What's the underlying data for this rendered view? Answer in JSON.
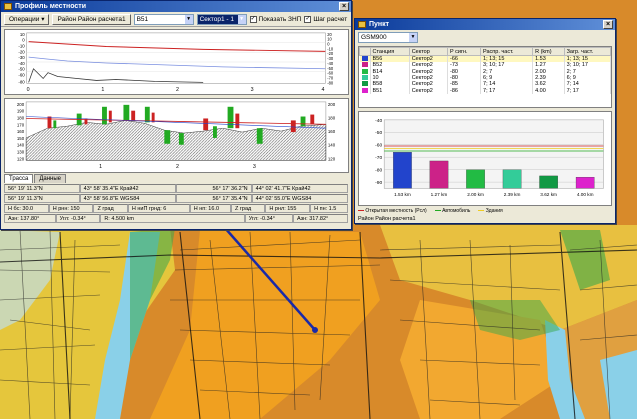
{
  "map": {
    "colors": {
      "orange": "#e8901c",
      "yellow": "#e8d040",
      "green": "#3aa84a",
      "water": "#8ad0e8",
      "route": "#1a2aa8"
    }
  },
  "profile_window": {
    "title": "Профиль местности",
    "toolbar": {
      "operations_label": "Операции",
      "link_label": "Район Район расчета1",
      "station_value": "B51",
      "sector_value": "Сектор1 - 1",
      "show_zone_label": "Показать ЗНП",
      "step_label": "Шаг расчет"
    },
    "top_chart": {
      "x_ticks": [
        "0",
        "1",
        "2",
        "3",
        "4"
      ],
      "y_left_ticks": [
        "10",
        "0",
        "-10",
        "-20",
        "-30",
        "-40",
        "-50",
        "-60",
        "-80"
      ],
      "y_right_ticks": [
        "20",
        "10",
        "0",
        "-10",
        "-20",
        "-30",
        "-40",
        "-50",
        "-60",
        "-70",
        "-80"
      ]
    },
    "bottom_chart": {
      "x_ticks": [
        "1",
        "2",
        "3"
      ],
      "y_left_ticks": [
        "200",
        "190",
        "180",
        "170",
        "160",
        "150",
        "140",
        "130",
        "120"
      ],
      "y_right_ticks": [
        "200",
        "180",
        "160",
        "140",
        "120"
      ]
    },
    "tabs": [
      "Трасса",
      "Данные"
    ],
    "status_rows": [
      [
        "56° 19' 11.3\"N",
        "43° 58' 35.4\"E Край42",
        "56° 17' 36.2\"N",
        "44° 02' 41.7\"E Край42"
      ],
      [
        "56° 19' 11.3\"N",
        "43° 58' 56.8\"E WGS84",
        "56° 17' 35.4\"N",
        "44° 02' 55.0\"E WGS84"
      ],
      [
        "Н бс: 30.0",
        "Н рнн: 150",
        "Z град",
        "Н ниП грнд: 6",
        "Н нп: 16.0",
        "Z град",
        "Н рнл: 155",
        "Н пн: 1.5"
      ],
      [
        "Азн: 137.80°",
        "Угл: -0.34°",
        "R: 4.500 km",
        "Угл: -0.34°",
        "Азн: 317.82°"
      ]
    ]
  },
  "station_window": {
    "title": "Пункт",
    "dropdown_value": "GSM900",
    "columns": [
      "Станция",
      "Сектор",
      "P сигн.",
      "Распр. част.",
      "R (km)",
      "Загр. част."
    ],
    "rows": [
      {
        "color": "#2244cc",
        "station": "B56",
        "sector": "Сектор2",
        "p": "-66",
        "freq": "1; 13; 15",
        "r": "1.53",
        "load": "1; 13; 15"
      },
      {
        "color": "#cc2288",
        "station": "B52",
        "sector": "Сектор2",
        "p": "-73",
        "freq": "3; 10; 17",
        "r": "1.27",
        "load": "3; 10; 17"
      },
      {
        "color": "#22bb44",
        "station": "B14",
        "sector": "Сектор2",
        "p": "-80",
        "freq": "2; 7",
        "r": "2.00",
        "load": "2; 7"
      },
      {
        "color": "#33cc99",
        "station": "10",
        "sector": "Сектор2",
        "p": "-80",
        "freq": "6; 9",
        "r": "2.39",
        "load": "6; 9"
      },
      {
        "color": "#119944",
        "station": "B58",
        "sector": "Сектор2",
        "p": "-85",
        "freq": "7; 14",
        "r": "3.62",
        "load": "7; 14"
      },
      {
        "color": "#dd22cc",
        "station": "B51",
        "sector": "Сектор2",
        "p": "-86",
        "freq": "7; 17",
        "r": "4.00",
        "load": "7; 17"
      }
    ],
    "chart_data": {
      "type": "bar",
      "categories": [
        "1.53 km",
        "1.27 km",
        "2.00 km",
        "2.39 km",
        "3.62 km",
        "4.00 km"
      ],
      "values": [
        -66,
        -73,
        -80,
        -80,
        -85,
        -86
      ],
      "colors": [
        "#2244cc",
        "#cc2288",
        "#22bb44",
        "#33cc99",
        "#119944",
        "#dd22cc"
      ],
      "y_ticks": [
        "-40",
        "-50",
        "-60",
        "-70",
        "-80",
        "-90"
      ],
      "ylim": [
        -95,
        -40
      ],
      "grid": true
    },
    "legend": [
      "Открытая местность (Рсл)",
      "Автомобиль",
      "Здания"
    ],
    "status": "Район Район расчета1"
  }
}
